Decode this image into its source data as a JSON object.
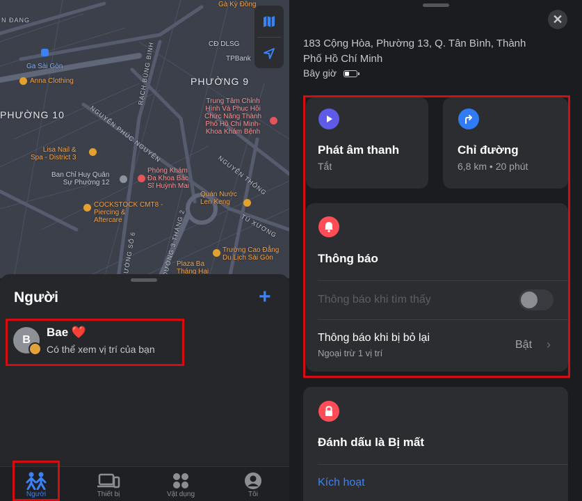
{
  "map": {
    "labels": [
      {
        "text": "Gà Kỳ Đồng",
        "cls": "poi"
      },
      {
        "text": "N ĐANG",
        "cls": "street"
      },
      {
        "text": "CĐ DLSG",
        "cls": ""
      },
      {
        "text": "TPBank",
        "cls": ""
      },
      {
        "text": "Ga Sài Gòn",
        "cls": "blue"
      },
      {
        "text": "Anna Clothing",
        "cls": "poi"
      },
      {
        "text": "RẠCH BÙNG BINH",
        "cls": "street"
      },
      {
        "text": "PHƯỜNG 9",
        "cls": "big"
      },
      {
        "text": "Trung Tâm Chỉnh\nHình Và Phục Hồi\nChức Năng Thành\nPhố Hồ Chí Minh-\nKhoa Khám Bệnh",
        "cls": "red"
      },
      {
        "text": "PHƯỜNG 10",
        "cls": "big"
      },
      {
        "text": "NGUYỄN PHÚC NGUYÊN",
        "cls": "street"
      },
      {
        "text": "Lisa Nail &\nSpa - District 3",
        "cls": "poi"
      },
      {
        "text": "NGUYỄN THÔNG",
        "cls": "street"
      },
      {
        "text": "Ban Chỉ Huy Quân\nSự Phường 12",
        "cls": ""
      },
      {
        "text": "Phòng Khám\nĐa Khoa Bác\nSĩ Huỳnh Mai",
        "cls": "red"
      },
      {
        "text": "Quán Nước\nLen Keng",
        "cls": "poi"
      },
      {
        "text": "COCKSTOCK CMT8 -\nPiercing &\nAftercare",
        "cls": "poi"
      },
      {
        "text": "TÚ XƯƠNG",
        "cls": "street"
      },
      {
        "text": "ĐƯỜNG 3 THÁNG 2",
        "cls": "street"
      },
      {
        "text": "Trường Cao Đẳng\nDu Lịch Sài Gòn",
        "cls": "poi"
      },
      {
        "text": "Plaza Ba\nTháng Hai",
        "cls": "poi"
      },
      {
        "text": "ƯỜNG SỐ 6",
        "cls": "street"
      }
    ]
  },
  "people": {
    "title": "Người",
    "person": {
      "initial": "B",
      "name": "Bae ❤️",
      "status": "Có thể xem vị trí của bạn"
    }
  },
  "tabs": [
    {
      "label": "Người",
      "icon": "people-icon",
      "active": true
    },
    {
      "label": "Thiết bị",
      "icon": "devices-icon",
      "active": false
    },
    {
      "label": "Vật dụng",
      "icon": "items-icon",
      "active": false
    },
    {
      "label": "Tôi",
      "icon": "me-icon",
      "active": false
    }
  ],
  "detail": {
    "address": "183 Cộng Hòa, Phường 13, Q. Tân Bình, Thành Phố Hồ Chí Minh",
    "time": "Bây giờ",
    "battery_level": 0.4,
    "play_sound": {
      "title": "Phát âm thanh",
      "sub": "Tắt",
      "color": "#5e5ce6"
    },
    "directions": {
      "title": "Chỉ đường",
      "sub": "6,8 km • 20 phút",
      "color": "#2f7cf6"
    },
    "notifications": {
      "title": "Thông báo",
      "color": "#ff4d57",
      "when_found": "Thông báo khi tìm thấy",
      "when_left": "Thông báo khi bị bỏ lại",
      "when_left_sub": "Ngoại trừ 1 vị trí",
      "when_left_value": "Bật"
    },
    "lost": {
      "title": "Đánh dấu là Bị mất",
      "action": "Kích hoạt",
      "color": "#ff4d57"
    }
  },
  "colors": {
    "accent": "#3a82f7",
    "highlight": "#d40d12"
  }
}
